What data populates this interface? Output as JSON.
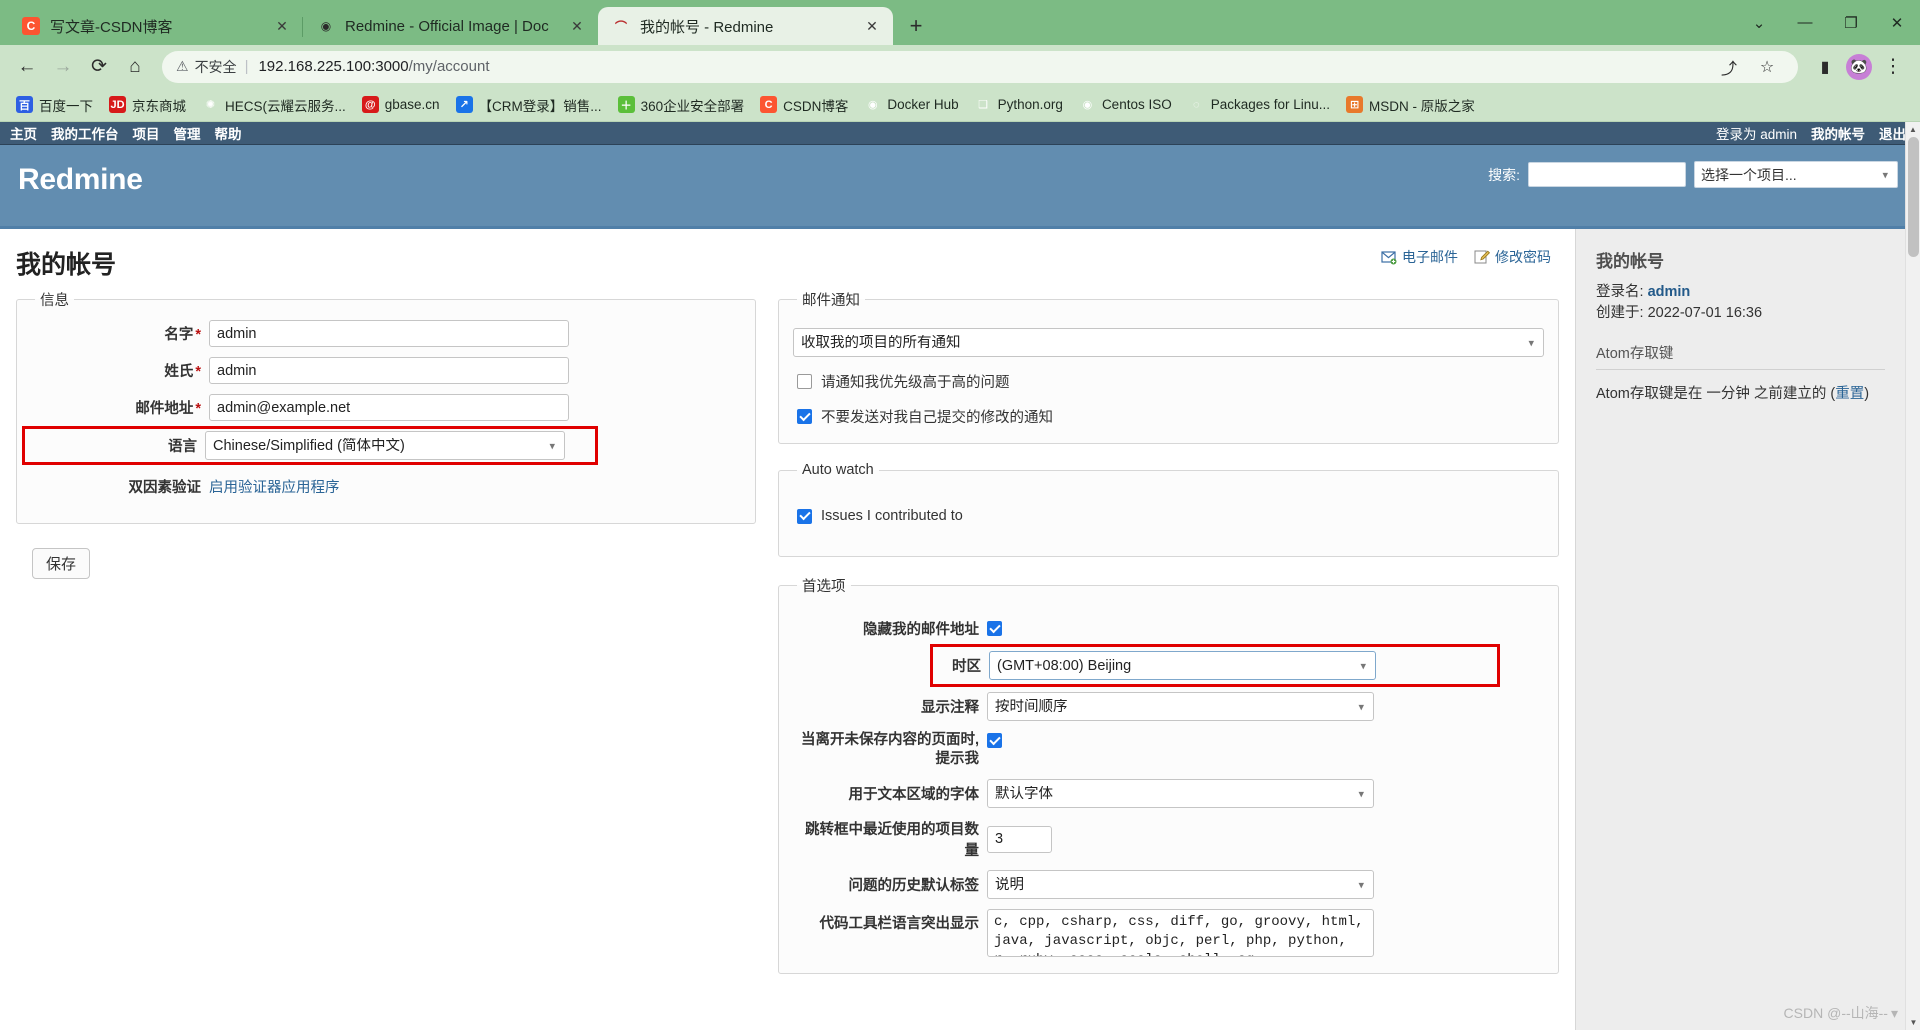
{
  "browser": {
    "tabs": [
      {
        "title": "写文章-CSDN博客",
        "icon": "csdn-favicon",
        "active": false,
        "close_label": "✕"
      },
      {
        "title": "Redmine - Official Image | Doc",
        "icon": "docker-favicon",
        "active": false,
        "close_label": "✕"
      },
      {
        "title": "我的帐号 - Redmine",
        "icon": "redmine-favicon",
        "active": true,
        "close_label": "✕"
      }
    ],
    "new_tab_label": "+",
    "window_controls": {
      "minimize": "—",
      "maximize": "❐",
      "close": "✕",
      "tab_search": "⌄"
    },
    "nav": {
      "back": "←",
      "forward": "→",
      "reload": "⟳",
      "home": "⌂"
    },
    "omnibox": {
      "warning_icon": "⚠",
      "security_text": "不安全",
      "separator": "|",
      "url_host": "192.168.225.100:3000",
      "url_path": "/my/account",
      "share_icon": "share-icon",
      "bookmark_icon": "star-icon"
    },
    "toolbar_right": {
      "sidepanel_icon": "side-panel-icon",
      "profile_initial": "🐼",
      "menu_icon": "⋮"
    },
    "bookmarks": [
      {
        "label": "百度一下",
        "icon": "baidu-icon",
        "icon_text": "百"
      },
      {
        "label": "京东商城",
        "icon": "jd-icon",
        "icon_text": "JD"
      },
      {
        "label": "HECS(云耀云服务...",
        "icon": "huawei-icon",
        "icon_text": "✺"
      },
      {
        "label": "gbase.cn",
        "icon": "gbase-icon",
        "icon_text": "@"
      },
      {
        "label": "【CRM登录】销售...",
        "icon": "crm-icon",
        "icon_text": "↗"
      },
      {
        "label": "360企业安全部署",
        "icon": "360-icon",
        "icon_text": "＋"
      },
      {
        "label": "CSDN博客",
        "icon": "csdn-icon",
        "icon_text": "C"
      },
      {
        "label": "Docker Hub",
        "icon": "docker-icon",
        "icon_text": "🐳"
      },
      {
        "label": "Python.org",
        "icon": "python-icon",
        "icon_text": "🐍"
      },
      {
        "label": "Centos ISO",
        "icon": "centos-icon",
        "icon_text": "◉"
      },
      {
        "label": "Packages for Linu...",
        "icon": "search-icon",
        "icon_text": "🔍"
      },
      {
        "label": "MSDN - 原版之家",
        "icon": "msdn-icon",
        "icon_text": "⊞"
      }
    ]
  },
  "redmine": {
    "topmenu": {
      "left": [
        "主页",
        "我的工作台",
        "项目",
        "管理",
        "帮助"
      ],
      "logged_in_as": "登录为 admin",
      "my_account": "我的帐号",
      "logout": "退出"
    },
    "header": {
      "logo": "Redmine",
      "search_label": "搜索:",
      "search_value": "",
      "search_placeholder": "",
      "project_selected": "选择一个项目..."
    },
    "page_title": "我的帐号",
    "contextual": [
      {
        "label": "电子邮件",
        "icon": "email-icon"
      },
      {
        "label": "修改密码",
        "icon": "edit-password-icon"
      }
    ],
    "info_fieldset": {
      "legend": "信息",
      "fields": [
        {
          "label": "名字",
          "required": "*",
          "value": "admin",
          "type": "text"
        },
        {
          "label": "姓氏",
          "required": "*",
          "value": "admin",
          "type": "text"
        },
        {
          "label": "邮件地址",
          "required": "*",
          "value": "admin@example.net",
          "type": "text"
        },
        {
          "label": "语言",
          "required": "",
          "value": "Chinese/Simplified (简体中文)",
          "type": "select",
          "highlighted": true
        }
      ],
      "twofa_label": "双因素验证",
      "twofa_link": "启用验证器应用程序"
    },
    "save_button": "保存",
    "mail_fieldset": {
      "legend": "邮件通知",
      "notification_select": "收取我的项目的所有通知",
      "checkboxes": [
        {
          "label": "请通知我优先级高于高的问题",
          "checked": false
        },
        {
          "label": "不要发送对我自己提交的修改的通知",
          "checked": true
        }
      ]
    },
    "autowatch_fieldset": {
      "legend": "Auto watch",
      "checkboxes": [
        {
          "label": "Issues I contributed to",
          "checked": true
        }
      ]
    },
    "prefs_fieldset": {
      "legend": "首选项",
      "rows": [
        {
          "label": "隐藏我的邮件地址",
          "type": "checkbox",
          "checked": true
        },
        {
          "label": "时区",
          "type": "select",
          "value": "(GMT+08:00) Beijing",
          "highlighted": true
        },
        {
          "label": "显示注释",
          "type": "select",
          "value": "按时间顺序"
        },
        {
          "label": "当离开未保存内容的页面时, 提示我",
          "type": "checkbox",
          "checked": true
        },
        {
          "label": "用于文本区域的字体",
          "type": "select",
          "value": "默认字体"
        },
        {
          "label": "跳转框中最近使用的项目数量",
          "type": "number",
          "value": "3"
        },
        {
          "label": "问题的历史默认标签",
          "type": "select",
          "value": "说明"
        },
        {
          "label": "代码工具栏语言突出显示",
          "type": "textarea",
          "value": "c, cpp, csharp, css, diff, go, groovy, html, java, javascript, objc, perl, php, python, r, ruby, sass, scala, shell, sq"
        }
      ]
    },
    "sidebar": {
      "title": "我的帐号",
      "login_label": "登录名:",
      "login_value": "admin",
      "created_label": "创建于:",
      "created_value": "2022-07-01 16:36",
      "atom_section_title": "Atom存取键",
      "atom_text_prefix": "Atom存取键是在",
      "atom_time": "一分钟",
      "atom_text_suffix": "之前建立的",
      "atom_reset_link": "重置"
    },
    "accent_colors": {
      "header_bg": "#628db0",
      "topmenu_bg": "#3e5b76",
      "link": "#2a6496",
      "highlight": "#e00000",
      "checkbox_on": "#1a73e8"
    }
  },
  "watermark": {
    "text": "CSDN @--山海--"
  }
}
